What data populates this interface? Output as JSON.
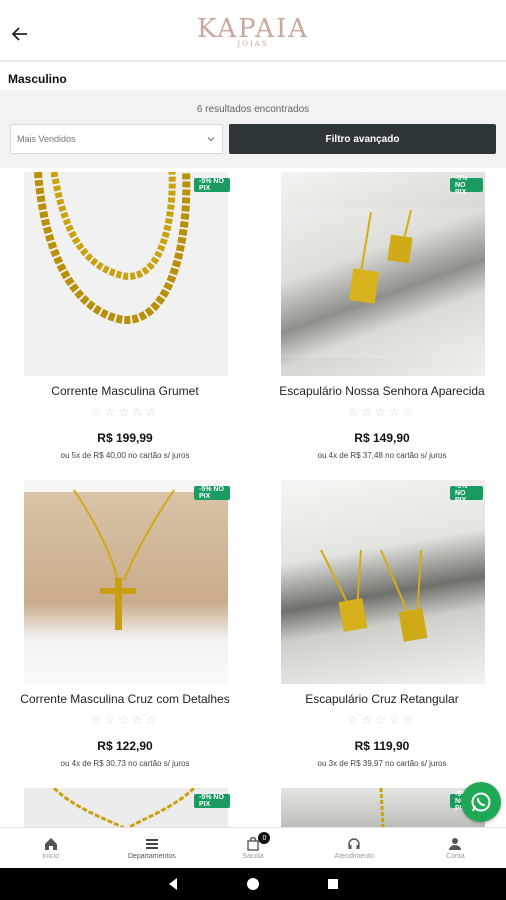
{
  "header": {
    "logo_text": "KAPAIA",
    "logo_sub": "JOIAS"
  },
  "category_title": "Masculino",
  "filter": {
    "results_text": "6 resultados encontrados",
    "sort_selected": "Mais Vendidos",
    "advanced_filter_label": "Filtro avançado"
  },
  "products": [
    {
      "name": "Corrente Masculina Grumet",
      "badge": "-5% NO PIX",
      "stars": "☆☆☆☆☆",
      "price": "R$ 199,99",
      "installments": "ou 5x de R$ 40,00 no cartão s/ juros"
    },
    {
      "name": "Escapulário Nossa Senhora Aparecida",
      "badge": "-5% NO PIX",
      "stars": "☆☆☆☆☆",
      "price": "R$ 149,90",
      "installments": "ou 4x de R$ 37,48 no cartão s/ juros"
    },
    {
      "name": "Corrente Masculina Cruz com Detalhes",
      "badge": "-5% NO PIX",
      "stars": "☆☆☆☆☆",
      "price": "R$ 122,90",
      "installments": "ou 4x de R$ 30,73 no cartão s/ juros"
    },
    {
      "name": "Escapulário Cruz Retangular",
      "badge": "-5% NO PIX",
      "stars": "☆☆☆☆☆",
      "price": "R$ 119,90",
      "installments": "ou 3x de R$ 39,97 no cartão s/ juros"
    },
    {
      "badge": "-5% NO PIX"
    },
    {
      "badge": "-5% NO PIX"
    }
  ],
  "bottom_nav": [
    {
      "label": "Início"
    },
    {
      "label": "Departamentos"
    },
    {
      "label": "Sacola",
      "badge": "0"
    },
    {
      "label": "Atendimento"
    },
    {
      "label": "Conta"
    }
  ],
  "colors": {
    "accent": "#2e3539",
    "pix_badge": "#1a9b61",
    "whatsapp": "#1fa855",
    "logo": "#caa79b"
  },
  "icons": [
    "back-arrow-icon",
    "chevron-down-icon",
    "whatsapp-icon",
    "home-icon",
    "departments-icon",
    "bag-icon",
    "headset-icon",
    "person-icon"
  ]
}
